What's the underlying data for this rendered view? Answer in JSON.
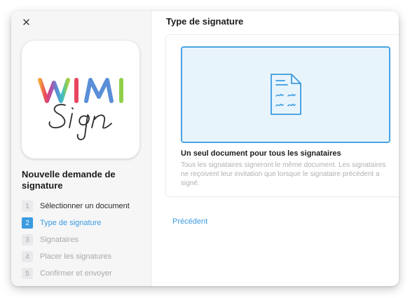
{
  "sidebar": {
    "title": "Nouvelle demande de signature",
    "steps": [
      {
        "number": "1",
        "label": "Sélectionner un document",
        "state": "done"
      },
      {
        "number": "2",
        "label": "Type de signature",
        "state": "active"
      },
      {
        "number": "3",
        "label": "Signataires",
        "state": "pending"
      },
      {
        "number": "4",
        "label": "Placer les signatures",
        "state": "pending"
      },
      {
        "number": "5",
        "label": "Confirmer et envoyer",
        "state": "pending"
      }
    ],
    "logo": {
      "word": "WIMI",
      "script": "Sign"
    }
  },
  "main": {
    "title": "Type de signature",
    "option": {
      "icon": "document-signature-icon",
      "title": "Un seul document pour tous les signataires",
      "description": "Tous les signataires signeront le même document. Les signataires ne reçoivent leur invitation que lorsque le signataire précédent a signé."
    },
    "previous_label": "Précédent"
  },
  "colors": {
    "accent": "#3a9be0",
    "selected_border": "#4aa3e2",
    "selected_bg": "#e8f4fc"
  }
}
